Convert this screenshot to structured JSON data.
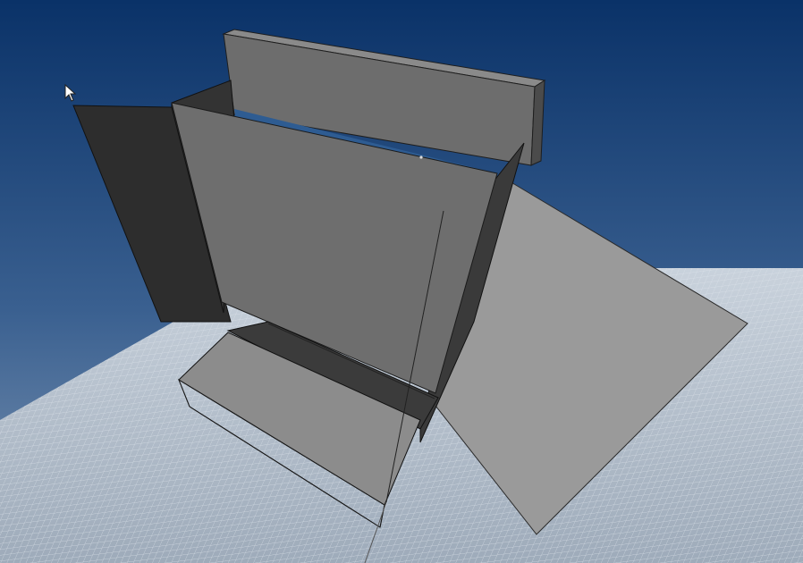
{
  "viewport": {
    "name": "3d-viewport",
    "background_top": "#0a3268",
    "background_bottom": "#aeb9c7",
    "ground_grid_color": "#d2d9e1",
    "ground_line_color": "#9fb0c2"
  },
  "scene": {
    "objects": [
      {
        "name": "back-wall-panel",
        "fill": "#6d6d6d"
      },
      {
        "name": "left-dark-panel",
        "fill": "#2d2d2d"
      },
      {
        "name": "front-main-panel",
        "fill": "#6e6e6e"
      },
      {
        "name": "right-side-panel",
        "fill": "#9a9a9a"
      },
      {
        "name": "bottom-tray",
        "fill": "#8c8c8c"
      }
    ]
  },
  "cursor": {
    "icon": "arrow-cursor-icon"
  }
}
